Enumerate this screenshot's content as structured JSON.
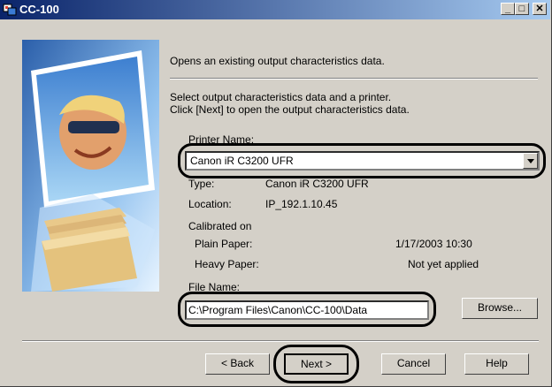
{
  "window": {
    "title": "CC-100",
    "minimize_glyph": "_",
    "maximize_glyph": "□",
    "close_glyph": "✕"
  },
  "intro": "Opens an existing output characteristics data.",
  "instructions": {
    "line1": "Select output characteristics data and a printer.",
    "line2": "Click [Next] to open the output characteristics data."
  },
  "printer": {
    "label": "Printer Name:",
    "selected": "Canon iR C3200 UFR",
    "type_label": "Type:",
    "type_value": "Canon iR C3200 UFR",
    "location_label": "Location:",
    "location_value": "IP_192.1.10.45"
  },
  "calibration": {
    "heading": "Calibrated on",
    "plain_label": "Plain Paper:",
    "plain_value": "1/17/2003  10:30",
    "heavy_label": "Heavy Paper:",
    "heavy_value": "Not yet applied"
  },
  "file": {
    "label": "File Name:",
    "value": "C:\\Program Files\\Canon\\CC-100\\Data",
    "browse": "Browse..."
  },
  "buttons": {
    "back": "< Back",
    "next": "Next >",
    "cancel": "Cancel",
    "help": "Help"
  },
  "colors": {
    "titlebar_start": "#0a246a",
    "titlebar_end": "#a6caf0",
    "dialog_bg": "#d4d0c8",
    "highlight_ring": "#000000"
  }
}
